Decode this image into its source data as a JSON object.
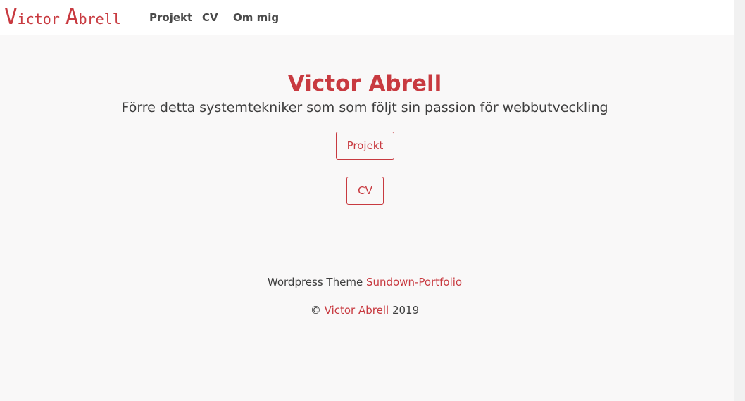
{
  "navbar": {
    "logo": {
      "first_initial": "V",
      "first_rest": "ictor",
      "last_initial": "A",
      "last_rest": "brell"
    },
    "links": {
      "projekt": "Projekt",
      "cv": "CV",
      "om_mig": "Om mig"
    }
  },
  "hero": {
    "title": "Victor Abrell",
    "subtitle": "Förre detta systemtekniker som som följt sin passion för webbutveckling",
    "buttons": {
      "projekt": "Projekt",
      "cv": "CV"
    }
  },
  "footer": {
    "theme_prefix": "Wordpress Theme",
    "theme_link": "Sundown-Portfolio",
    "copyright_symbol": "©",
    "copyright_name": "Victor Abrell",
    "copyright_year": "2019"
  },
  "colors": {
    "accent": "#c83a40",
    "text": "#3d3d3d",
    "background": "#f9f8f8",
    "navbar": "#ffffff"
  }
}
